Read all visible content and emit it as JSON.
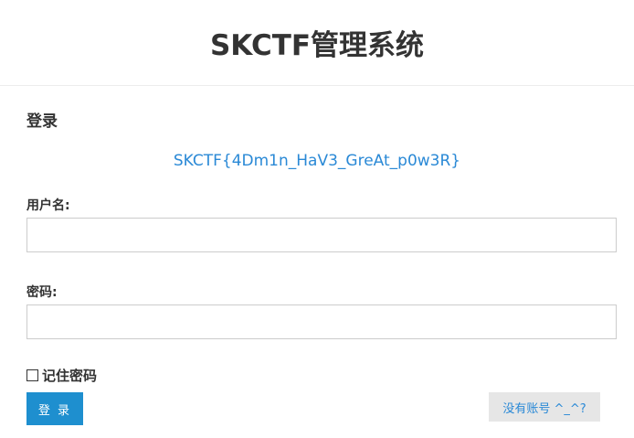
{
  "header": {
    "title": "SKCTF管理系统"
  },
  "login": {
    "section_title": "登录",
    "flag_text": "SKCTF{4Dm1n_HaV3_GreAt_p0w3R}",
    "username_label": "用户名:",
    "username_value": "",
    "password_label": "密码:",
    "password_value": "",
    "remember_label": "记住密码",
    "remember_checked": false,
    "submit_label": "登 录",
    "register_label": "没有账号 ^_^?"
  },
  "colors": {
    "accent": "#1e8fcf",
    "link": "#2a89d6",
    "secondary_button": "#e6e6e6"
  }
}
